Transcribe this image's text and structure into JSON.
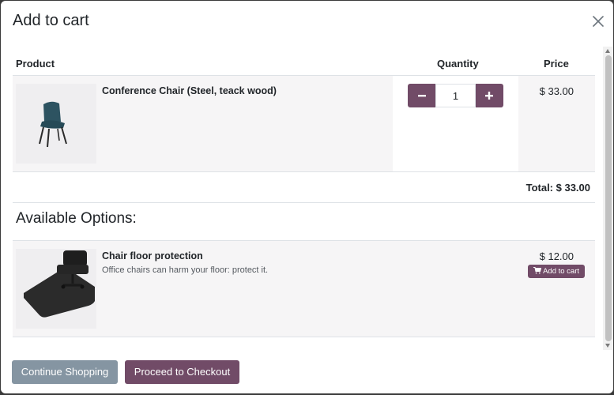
{
  "modal": {
    "title": "Add to cart",
    "close_icon": "close-icon"
  },
  "table": {
    "headers": {
      "product": "Product",
      "quantity": "Quantity",
      "price": "Price"
    },
    "product": {
      "name": "Conference Chair (Steel, teack wood)",
      "quantity": "1",
      "price": "$ 33.00",
      "image_icon": "chair-image"
    },
    "total": "Total: $ 33.00"
  },
  "options": {
    "title": "Available Options:",
    "items": [
      {
        "name": "Chair floor protection",
        "description": "Office chairs can harm your floor: protect it.",
        "price": "$ 12.00",
        "add_label": "Add to cart",
        "icon": "cart-icon",
        "image_icon": "floor-mat-image"
      }
    ]
  },
  "footer": {
    "continue_label": "Continue Shopping",
    "checkout_label": "Proceed to Checkout"
  },
  "colors": {
    "primary": "#714b67",
    "secondary": "#8595a2",
    "row_bg": "#f6f5f6"
  }
}
